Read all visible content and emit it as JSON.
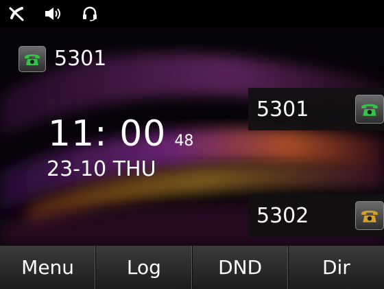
{
  "status_bar": {
    "icons": [
      "mute-icon",
      "speaker-icon",
      "headset-icon"
    ]
  },
  "account": {
    "label": "5301",
    "icon": "phone-registered-icon",
    "icon_color": "#33c24a"
  },
  "clock": {
    "time": "11: 00",
    "seconds": "48",
    "date": "23-10 THU"
  },
  "line_keys": [
    {
      "label": "5301",
      "icon": "phone-registered-icon",
      "icon_color": "#33c24a"
    },
    {
      "label": "5302",
      "icon": "phone-unregistered-icon",
      "icon_color": "#d6a12a"
    }
  ],
  "softkeys": [
    {
      "label": "Menu"
    },
    {
      "label": "Log"
    },
    {
      "label": "DND"
    },
    {
      "label": "Dir"
    }
  ]
}
